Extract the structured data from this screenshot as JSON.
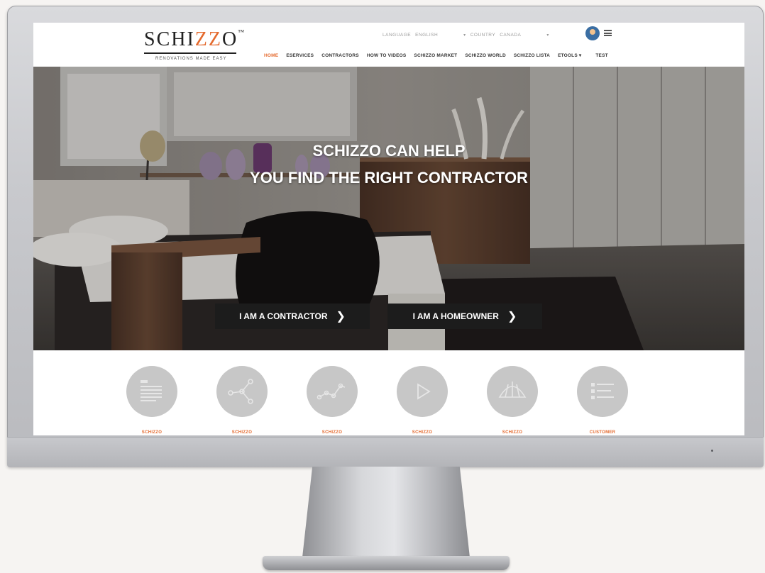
{
  "header": {
    "logo": {
      "word_prefix": "SCHI",
      "word_accent": "ZZ",
      "word_suffix": "O",
      "trademark": "™",
      "tagline": "RENOVATIONS MADE EASY"
    },
    "language_label": "LANGUAGE",
    "language_value": "ENGLISH",
    "country_label": "COUNTRY",
    "country_value": "CANADA",
    "dropdown_caret": "▾",
    "nav": [
      {
        "label": "HOME",
        "active": true
      },
      {
        "label": "ESERVICES"
      },
      {
        "label": "CONTRACTORS"
      },
      {
        "label": "HOW TO VIDEOS"
      },
      {
        "label": "SCHIZZO MARKET"
      },
      {
        "label": "SCHIZZO WORLD"
      },
      {
        "label": "SCHIZZO LISTA"
      },
      {
        "label": "ETOOLS ▾"
      },
      {
        "label": "TEST"
      }
    ]
  },
  "hero": {
    "title_line1": "SCHIZZO CAN HELP",
    "title_line2": "YOU FIND THE RIGHT CONTRACTOR",
    "contractor_button": "I AM A CONTRACTOR",
    "homeowner_button": "I AM A HOMEOWNER",
    "button_chevron": "❯"
  },
  "features": [
    {
      "label": "SCHIZZO\nLISTA",
      "icon": "list-document-icon"
    },
    {
      "label": "SCHIZZO\nMARKET",
      "icon": "network-nodes-icon"
    },
    {
      "label": "SCHIZZO\nWORLD",
      "icon": "line-graph-icon"
    },
    {
      "label": "SCHIZZO\nVIDEOS",
      "icon": "play-icon"
    },
    {
      "label": "SCHIZZO\nCONTRACTORS",
      "icon": "dome-tent-icon"
    },
    {
      "label": "CUSTOMER\nREVIEWS",
      "icon": "checklist-icon"
    }
  ],
  "colors": {
    "accent": "#e46a2e",
    "cta_background": "#1c1c1c",
    "feature_circle": "#c7c7c7"
  }
}
